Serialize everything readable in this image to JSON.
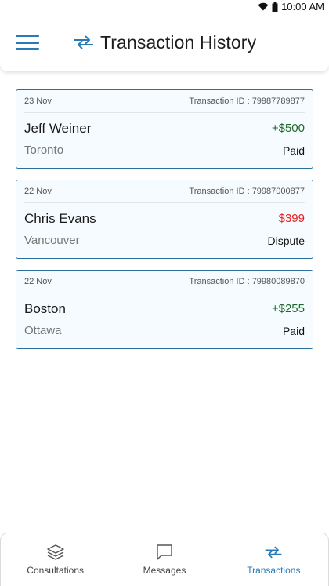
{
  "status_bar": {
    "time": "10:00 AM"
  },
  "header": {
    "title": "Transaction History"
  },
  "transactions": [
    {
      "date": "23 Nov",
      "transaction_id": "Transaction ID : 79987789877",
      "name": "Jeff Weiner",
      "amount": "+$500",
      "amount_type": "credit",
      "city": "Toronto",
      "status": "Paid"
    },
    {
      "date": "22 Nov",
      "transaction_id": "Transaction ID : 79987000877",
      "name": "Chris Evans",
      "amount": "$399",
      "amount_type": "dispute",
      "city": "Vancouver",
      "status": "Dispute"
    },
    {
      "date": "22 Nov",
      "transaction_id": "Transaction ID : 79980089870",
      "name": "Boston",
      "amount": "+$255",
      "amount_type": "credit",
      "city": "Ottawa",
      "status": "Paid"
    }
  ],
  "bottom_nav": {
    "items": [
      {
        "label": "Consultations",
        "icon": "layers-icon",
        "active": false
      },
      {
        "label": "Messages",
        "icon": "chat-icon",
        "active": false
      },
      {
        "label": "Transactions",
        "icon": "transfer-icon",
        "active": true
      }
    ]
  },
  "colors": {
    "accent": "#2a7ab8",
    "credit": "#1e6a2a",
    "dispute": "#e82020",
    "card_border": "#2b6f9f"
  }
}
